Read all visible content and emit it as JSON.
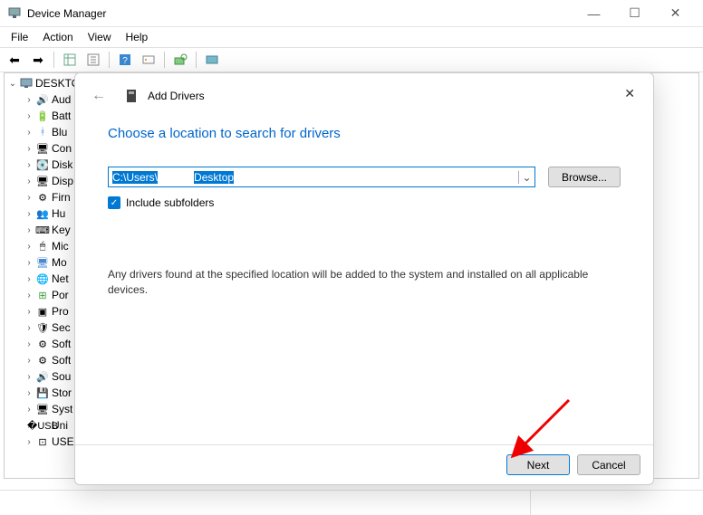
{
  "window": {
    "title": "Device Manager",
    "controls": {
      "min": "—",
      "max": "☐",
      "close": "✕"
    }
  },
  "menu": {
    "file": "File",
    "action": "Action",
    "view": "View",
    "help": "Help"
  },
  "tree": {
    "root": "DESKTO",
    "items": [
      {
        "icon": "🔊",
        "label": "Aud"
      },
      {
        "icon": "🔋",
        "label": "Batt"
      },
      {
        "icon": "ᚼ",
        "label": "Blu",
        "cls": "ic-blue"
      },
      {
        "icon": "🖥",
        "label": "Con"
      },
      {
        "icon": "💽",
        "label": "Disk"
      },
      {
        "icon": "🖥",
        "label": "Disp"
      },
      {
        "icon": "⚙",
        "label": "Firn"
      },
      {
        "icon": "👥",
        "label": "Hu"
      },
      {
        "icon": "⌨",
        "label": "Key"
      },
      {
        "icon": "🖱",
        "label": "Mic"
      },
      {
        "icon": "🖥",
        "label": "Mo",
        "cls": "ic-blue"
      },
      {
        "icon": "🌐",
        "label": "Net",
        "cls": "ic-blue"
      },
      {
        "icon": "⊞",
        "label": "Por",
        "cls": "ic-green"
      },
      {
        "icon": "▣",
        "label": "Pro"
      },
      {
        "icon": "🛡",
        "label": "Sec"
      },
      {
        "icon": "⚙",
        "label": "Soft"
      },
      {
        "icon": "⚙",
        "label": "Soft"
      },
      {
        "icon": "🔊",
        "label": "Sou"
      },
      {
        "icon": "💾",
        "label": "Stor"
      },
      {
        "icon": "🖥",
        "label": "Syst"
      },
      {
        "icon": "�USB",
        "label": "Uni"
      },
      {
        "icon": "⊡",
        "label": "USE"
      }
    ]
  },
  "dialog": {
    "title": "Add Drivers",
    "heading": "Choose a location to search for drivers",
    "path_pre": "C:\\Users\\",
    "path_gap": "            ",
    "path_post": "Desktop",
    "browse": "Browse...",
    "include_label": "Include subfolders",
    "info": "Any drivers found at the specified location will be added to the system and installed on all applicable devices.",
    "next": "Next",
    "cancel": "Cancel"
  }
}
